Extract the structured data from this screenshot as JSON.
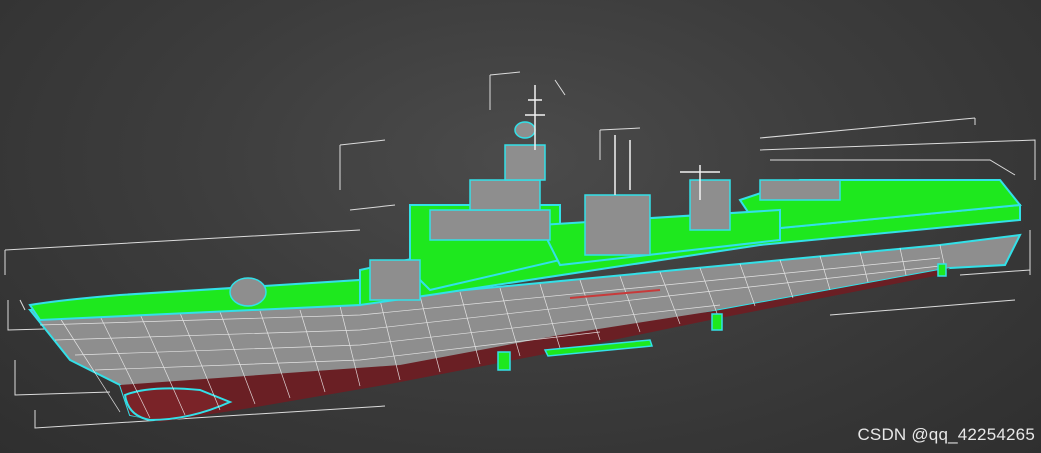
{
  "watermark": {
    "text": "CSDN @qq_42254265"
  },
  "colors": {
    "background": "#3d3d3d",
    "selection_green": "#1ee81e",
    "outline_cyan": "#33e0e8",
    "wire_white": "#f2f2f2",
    "hull_grey": "#8e8e8e",
    "hull_red": "#6a1f24",
    "bbox_white": "#dcdcdc"
  },
  "icons": [
    "ship-wireframe-model"
  ]
}
